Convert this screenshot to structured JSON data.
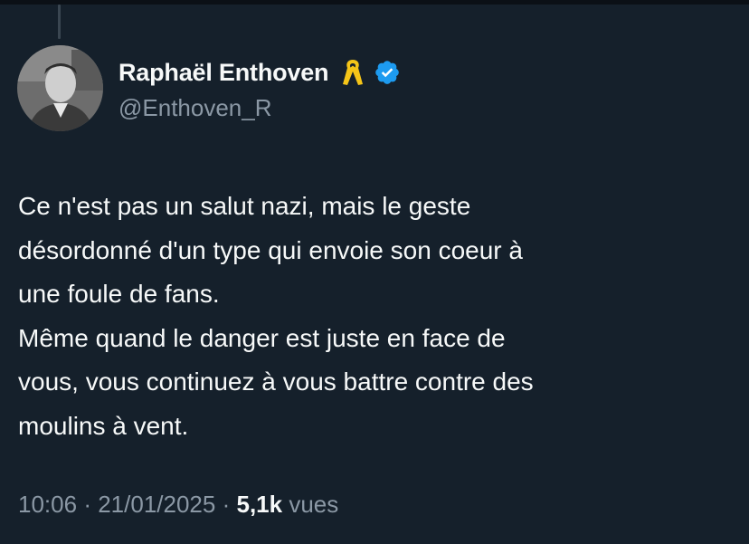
{
  "author": {
    "display_name": "Raphaël Enthoven",
    "handle": "@Enthoven_R",
    "badges": [
      "yellow-ribbon-icon",
      "verified-badge-icon"
    ]
  },
  "tweet": {
    "lines": [
      "Ce n'est pas un salut nazi, mais le geste",
      "désordonné d'un type qui envoie son coeur à",
      "une foule de fans.",
      "Même quand le danger est juste en face de",
      "vous, vous continuez à vous battre contre des",
      "moulins à vent."
    ]
  },
  "meta": {
    "time": "10:06",
    "separator": "·",
    "date": "21/01/2025",
    "views_count": "5,1k",
    "views_label": "vues"
  },
  "colors": {
    "background": "#15202b",
    "primary_text": "#f7f9f9",
    "secondary_text": "#8b98a5",
    "verified": "#1d9bf0",
    "ribbon": "#f5c518"
  }
}
